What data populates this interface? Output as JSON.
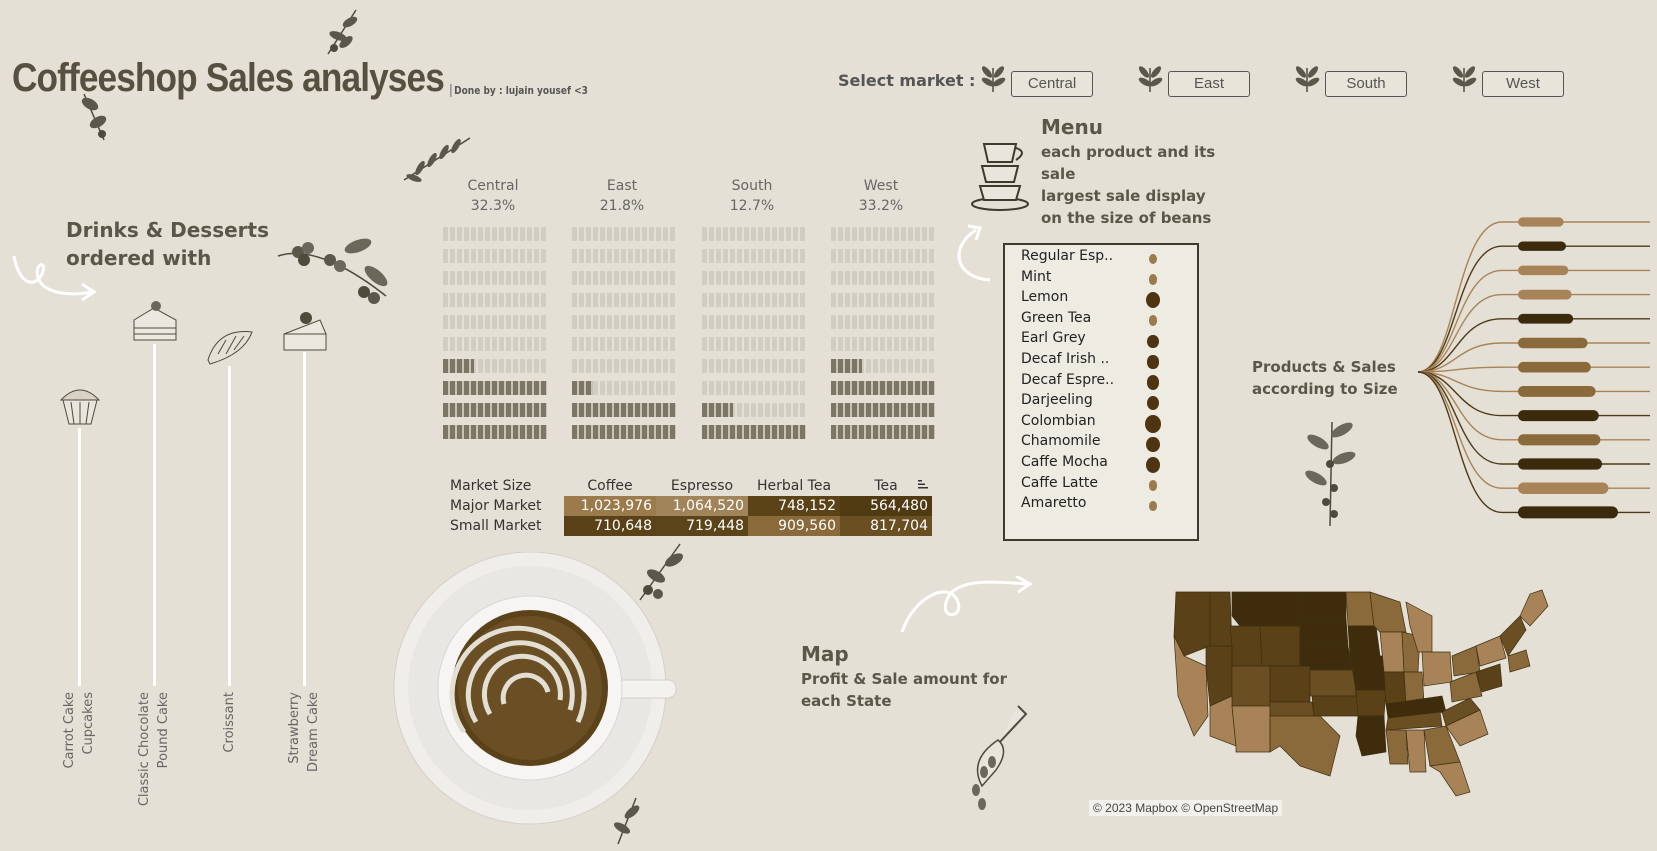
{
  "header": {
    "title": "Coffeeshop Sales analyses",
    "byline": "Done by : lujain yousef <3",
    "select_label": "Select market :",
    "markets": [
      "Central",
      "East",
      "South",
      "West"
    ]
  },
  "desserts": {
    "title_line1": "Drinks & Desserts",
    "title_line2": "ordered with",
    "items": [
      {
        "line1": "Carrot Cake",
        "line2": "Cupcakes"
      },
      {
        "line1": "Classic Chocolate",
        "line2": "Pound Cake"
      },
      {
        "line1": "Croissant",
        "line2": ""
      },
      {
        "line1": "Strawberry",
        "line2": "Dream Cake"
      }
    ]
  },
  "market_share": {
    "columns": [
      {
        "name": "Central",
        "pct": "32.3%"
      },
      {
        "name": "East",
        "pct": "21.8%"
      },
      {
        "name": "South",
        "pct": "12.7%"
      },
      {
        "name": "West",
        "pct": "33.2%"
      }
    ],
    "fill_rows": [
      [
        0,
        0,
        0,
        0
      ],
      [
        0,
        0,
        0,
        0
      ],
      [
        0,
        0,
        0,
        0
      ],
      [
        0,
        0,
        0,
        0
      ],
      [
        0,
        0,
        0,
        0
      ],
      [
        0,
        0,
        0,
        0
      ],
      [
        0.3,
        0,
        0,
        0.3
      ],
      [
        1,
        0.2,
        0,
        1
      ],
      [
        1,
        1,
        0.3,
        1
      ],
      [
        1,
        1,
        1,
        1
      ]
    ]
  },
  "size_table": {
    "headers": [
      "Market Size",
      "Coffee",
      "Espresso",
      "Herbal Tea",
      "Tea"
    ],
    "rows": [
      {
        "label": "Major Market",
        "values": [
          "1,023,976",
          "1,064,520",
          "748,152",
          "564,480"
        ],
        "colors": [
          "#9b7a4c",
          "#a2845a",
          "#5b4217",
          "#4f3a12"
        ]
      },
      {
        "label": "Small Market",
        "values": [
          "710,648",
          "719,448",
          "909,560",
          "817,704"
        ],
        "colors": [
          "#5a4118",
          "#5c441a",
          "#8a6a3a",
          "#6a4f22"
        ]
      }
    ]
  },
  "menu": {
    "title": "Menu",
    "sub": [
      "each product and its",
      "sale",
      "largest sale display",
      "on the size of beans"
    ],
    "items": [
      {
        "name": "Regular Esp..",
        "bean": 0.3
      },
      {
        "name": "Mint",
        "bean": 0.35
      },
      {
        "name": "Lemon",
        "bean": 0.85
      },
      {
        "name": "Green Tea",
        "bean": 0.35
      },
      {
        "name": "Earl Grey",
        "bean": 0.6
      },
      {
        "name": "Decaf Irish ..",
        "bean": 0.55
      },
      {
        "name": "Decaf Espre..",
        "bean": 0.7
      },
      {
        "name": "Darjeeling",
        "bean": 0.65
      },
      {
        "name": "Colombian",
        "bean": 1.0
      },
      {
        "name": "Chamomile",
        "bean": 0.75
      },
      {
        "name": "Caffe Mocha",
        "bean": 0.8
      },
      {
        "name": "Caffe Latte",
        "bean": 0.35
      },
      {
        "name": "Amaretto",
        "bean": 0.25
      }
    ]
  },
  "size_tree": {
    "title_line1": "Products & Sales",
    "title_line2": "according to Size",
    "bars": [
      0.32,
      0.35,
      0.38,
      0.42,
      0.44,
      0.62,
      0.66,
      0.72,
      0.76,
      0.78,
      0.8,
      0.88,
      1.0
    ],
    "colors": [
      "#a88357",
      "#3b2a0c",
      "#a88357",
      "#a88357",
      "#3b2a0c",
      "#8a6a3a",
      "#8a6a3a",
      "#8a6a3a",
      "#3b2a0c",
      "#8a6a3a",
      "#3b2a0c",
      "#a88357",
      "#3b2a0c"
    ]
  },
  "map": {
    "title": "Map",
    "sub_line1": "Profit & Sale amount for",
    "sub_line2": "each State",
    "attribution": "© 2023 Mapbox © OpenStreetMap"
  }
}
